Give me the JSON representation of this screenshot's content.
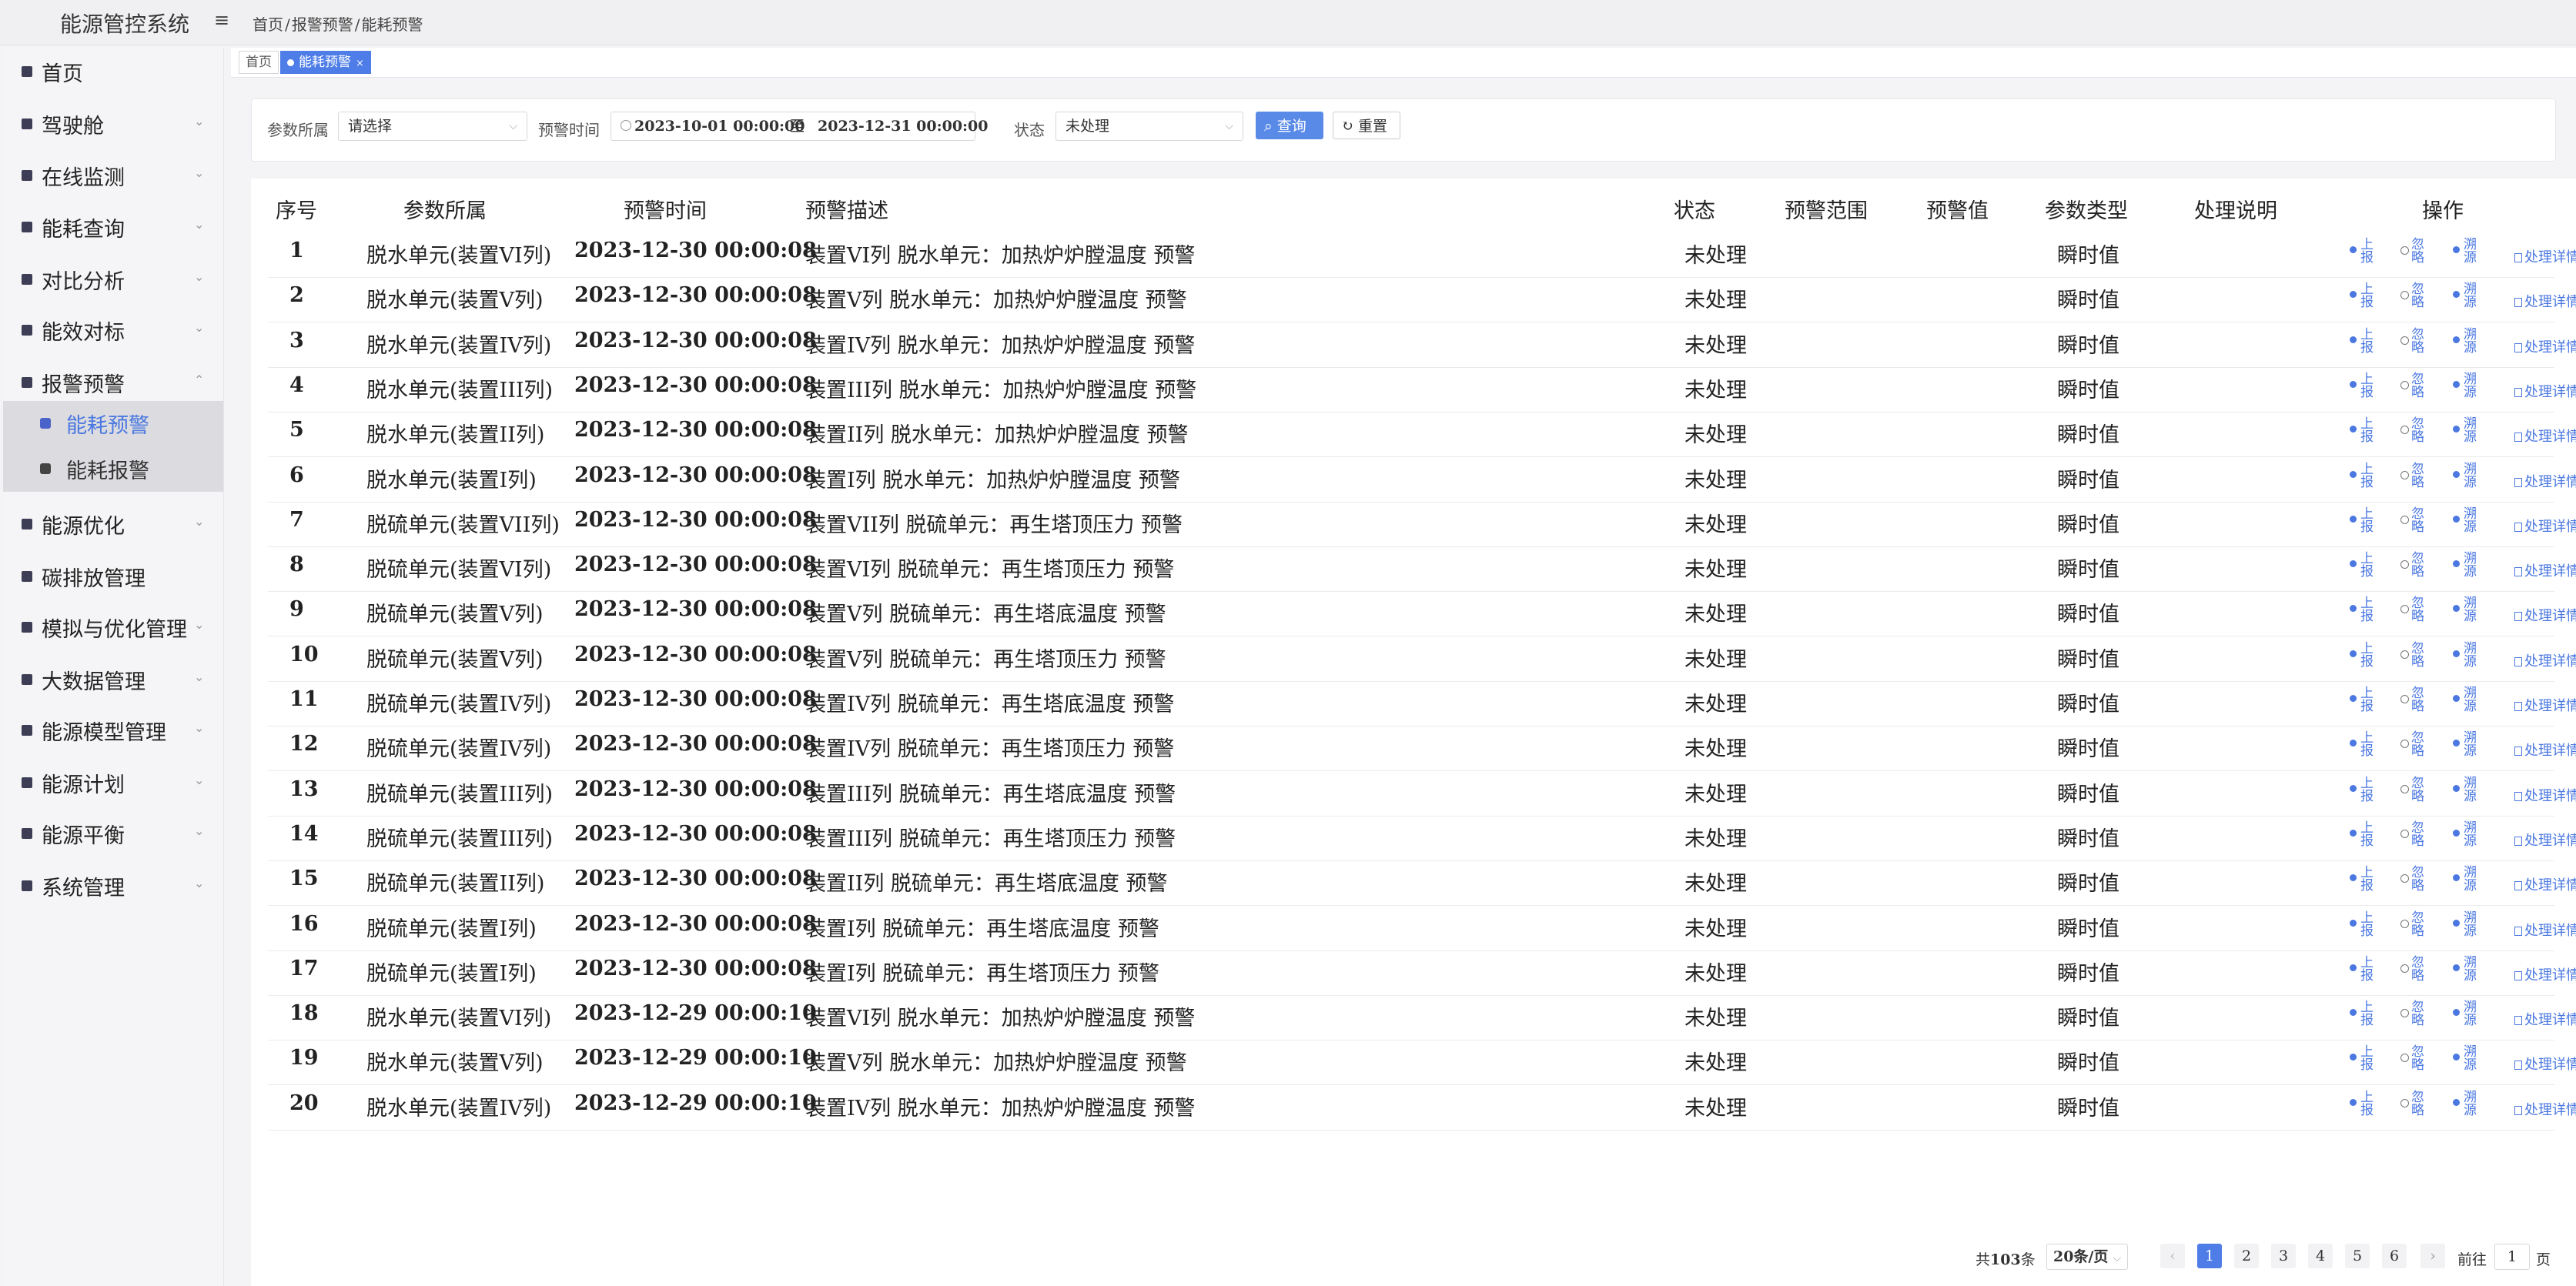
{
  "app": {
    "title": "能源管控系统"
  },
  "breadcrumb": [
    "首页",
    "报警预警",
    "能耗预警"
  ],
  "sidebar": {
    "items": [
      {
        "label": "首页",
        "has_children": false
      },
      {
        "label": "驾驶舱",
        "has_children": true
      },
      {
        "label": "在线监测",
        "has_children": true
      },
      {
        "label": "能耗查询",
        "has_children": true
      },
      {
        "label": "对比分析",
        "has_children": true
      },
      {
        "label": "能效对标",
        "has_children": true
      },
      {
        "label": "报警预警",
        "has_children": true,
        "expanded": true
      },
      {
        "label": "能源优化",
        "has_children": true
      },
      {
        "label": "碳排放管理",
        "has_children": false
      },
      {
        "label": "模拟与优化管理",
        "has_children": true
      },
      {
        "label": "大数据管理",
        "has_children": true
      },
      {
        "label": "能源模型管理",
        "has_children": true
      },
      {
        "label": "能源计划",
        "has_children": true
      },
      {
        "label": "能源平衡",
        "has_children": true
      },
      {
        "label": "系统管理",
        "has_children": true
      }
    ],
    "sub_items": [
      {
        "label": "能耗预警",
        "active": true
      },
      {
        "label": "能耗报警",
        "active": false
      }
    ]
  },
  "tabs": [
    {
      "label": "首页",
      "active": false
    },
    {
      "label": "能耗预警",
      "active": true,
      "close": "×"
    }
  ],
  "filters": {
    "param_label": "参数所属",
    "param_value": "请选择",
    "time_label": "预警时间",
    "time_start": "2023-10-01 00:00:00",
    "time_sep": "至",
    "time_end": "2023-12-31 00:00:00",
    "status_label": "状态",
    "status_value": "未处理",
    "query_label": "查询",
    "reset_label": "重置"
  },
  "table": {
    "columns": [
      "序号",
      "参数所属",
      "预警时间",
      "预警描述",
      "状态",
      "预警范围",
      "预警值",
      "参数类型",
      "处理说明",
      "操作"
    ],
    "rows": [
      {
        "no": "1",
        "param": "脱水单元(装置VI列)",
        "time": "2023-12-30 00:00:08",
        "desc": "装置VI列 脱水单元：加热炉炉膛温度 预警",
        "status": "未处理",
        "type": "瞬时值"
      },
      {
        "no": "2",
        "param": "脱水单元(装置V列)",
        "time": "2023-12-30 00:00:08",
        "desc": "装置V列 脱水单元：加热炉炉膛温度 预警",
        "status": "未处理",
        "type": "瞬时值"
      },
      {
        "no": "3",
        "param": "脱水单元(装置IV列)",
        "time": "2023-12-30 00:00:08",
        "desc": "装置IV列 脱水单元：加热炉炉膛温度 预警",
        "status": "未处理",
        "type": "瞬时值"
      },
      {
        "no": "4",
        "param": "脱水单元(装置III列)",
        "time": "2023-12-30 00:00:08",
        "desc": "装置III列 脱水单元：加热炉炉膛温度 预警",
        "status": "未处理",
        "type": "瞬时值"
      },
      {
        "no": "5",
        "param": "脱水单元(装置II列)",
        "time": "2023-12-30 00:00:08",
        "desc": "装置II列 脱水单元：加热炉炉膛温度 预警",
        "status": "未处理",
        "type": "瞬时值"
      },
      {
        "no": "6",
        "param": "脱水单元(装置I列)",
        "time": "2023-12-30 00:00:08",
        "desc": "装置I列 脱水单元：加热炉炉膛温度 预警",
        "status": "未处理",
        "type": "瞬时值"
      },
      {
        "no": "7",
        "param": "脱硫单元(装置VII列)",
        "time": "2023-12-30 00:00:08",
        "desc": "装置VII列 脱硫单元：再生塔顶压力 预警",
        "status": "未处理",
        "type": "瞬时值"
      },
      {
        "no": "8",
        "param": "脱硫单元(装置VI列)",
        "time": "2023-12-30 00:00:08",
        "desc": "装置VI列 脱硫单元：再生塔顶压力 预警",
        "status": "未处理",
        "type": "瞬时值"
      },
      {
        "no": "9",
        "param": "脱硫单元(装置V列)",
        "time": "2023-12-30 00:00:08",
        "desc": "装置V列 脱硫单元：再生塔底温度 预警",
        "status": "未处理",
        "type": "瞬时值"
      },
      {
        "no": "10",
        "param": "脱硫单元(装置V列)",
        "time": "2023-12-30 00:00:08",
        "desc": "装置V列 脱硫单元：再生塔顶压力 预警",
        "status": "未处理",
        "type": "瞬时值"
      },
      {
        "no": "11",
        "param": "脱硫单元(装置IV列)",
        "time": "2023-12-30 00:00:08",
        "desc": "装置IV列 脱硫单元：再生塔底温度 预警",
        "status": "未处理",
        "type": "瞬时值"
      },
      {
        "no": "12",
        "param": "脱硫单元(装置IV列)",
        "time": "2023-12-30 00:00:08",
        "desc": "装置IV列 脱硫单元：再生塔顶压力 预警",
        "status": "未处理",
        "type": "瞬时值"
      },
      {
        "no": "13",
        "param": "脱硫单元(装置III列)",
        "time": "2023-12-30 00:00:08",
        "desc": "装置III列 脱硫单元：再生塔底温度 预警",
        "status": "未处理",
        "type": "瞬时值"
      },
      {
        "no": "14",
        "param": "脱硫单元(装置III列)",
        "time": "2023-12-30 00:00:08",
        "desc": "装置III列 脱硫单元：再生塔顶压力 预警",
        "status": "未处理",
        "type": "瞬时值"
      },
      {
        "no": "15",
        "param": "脱硫单元(装置II列)",
        "time": "2023-12-30 00:00:08",
        "desc": "装置II列 脱硫单元：再生塔底温度 预警",
        "status": "未处理",
        "type": "瞬时值"
      },
      {
        "no": "16",
        "param": "脱硫单元(装置I列)",
        "time": "2023-12-30 00:00:08",
        "desc": "装置I列 脱硫单元：再生塔底温度 预警",
        "status": "未处理",
        "type": "瞬时值"
      },
      {
        "no": "17",
        "param": "脱硫单元(装置I列)",
        "time": "2023-12-30 00:00:08",
        "desc": "装置I列 脱硫单元：再生塔顶压力 预警",
        "status": "未处理",
        "type": "瞬时值"
      },
      {
        "no": "18",
        "param": "脱水单元(装置VI列)",
        "time": "2023-12-29 00:00:10",
        "desc": "装置VI列 脱水单元：加热炉炉膛温度 预警",
        "status": "未处理",
        "type": "瞬时值"
      },
      {
        "no": "19",
        "param": "脱水单元(装置V列)",
        "time": "2023-12-29 00:00:10",
        "desc": "装置V列 脱水单元：加热炉炉膛温度 预警",
        "status": "未处理",
        "type": "瞬时值"
      },
      {
        "no": "20",
        "param": "脱水单元(装置IV列)",
        "time": "2023-12-29 00:00:10",
        "desc": "装置IV列 脱水单元：加热炉炉膛温度 预警",
        "status": "未处理",
        "type": "瞬时值"
      }
    ],
    "actions": {
      "report": "上报",
      "ignore": "忽略",
      "trace": "溯源",
      "detail": "处理详情"
    }
  },
  "pagination": {
    "total_prefix": "共",
    "total": "103",
    "total_suffix": "条",
    "page_size": "20条/页",
    "pages": [
      "1",
      "2",
      "3",
      "4",
      "5",
      "6"
    ],
    "current": "1",
    "goto_prefix": "前往",
    "goto_value": "1",
    "goto_suffix": "页"
  },
  "colors": {
    "primary": "#4e7de8",
    "link": "#4a77e0"
  }
}
